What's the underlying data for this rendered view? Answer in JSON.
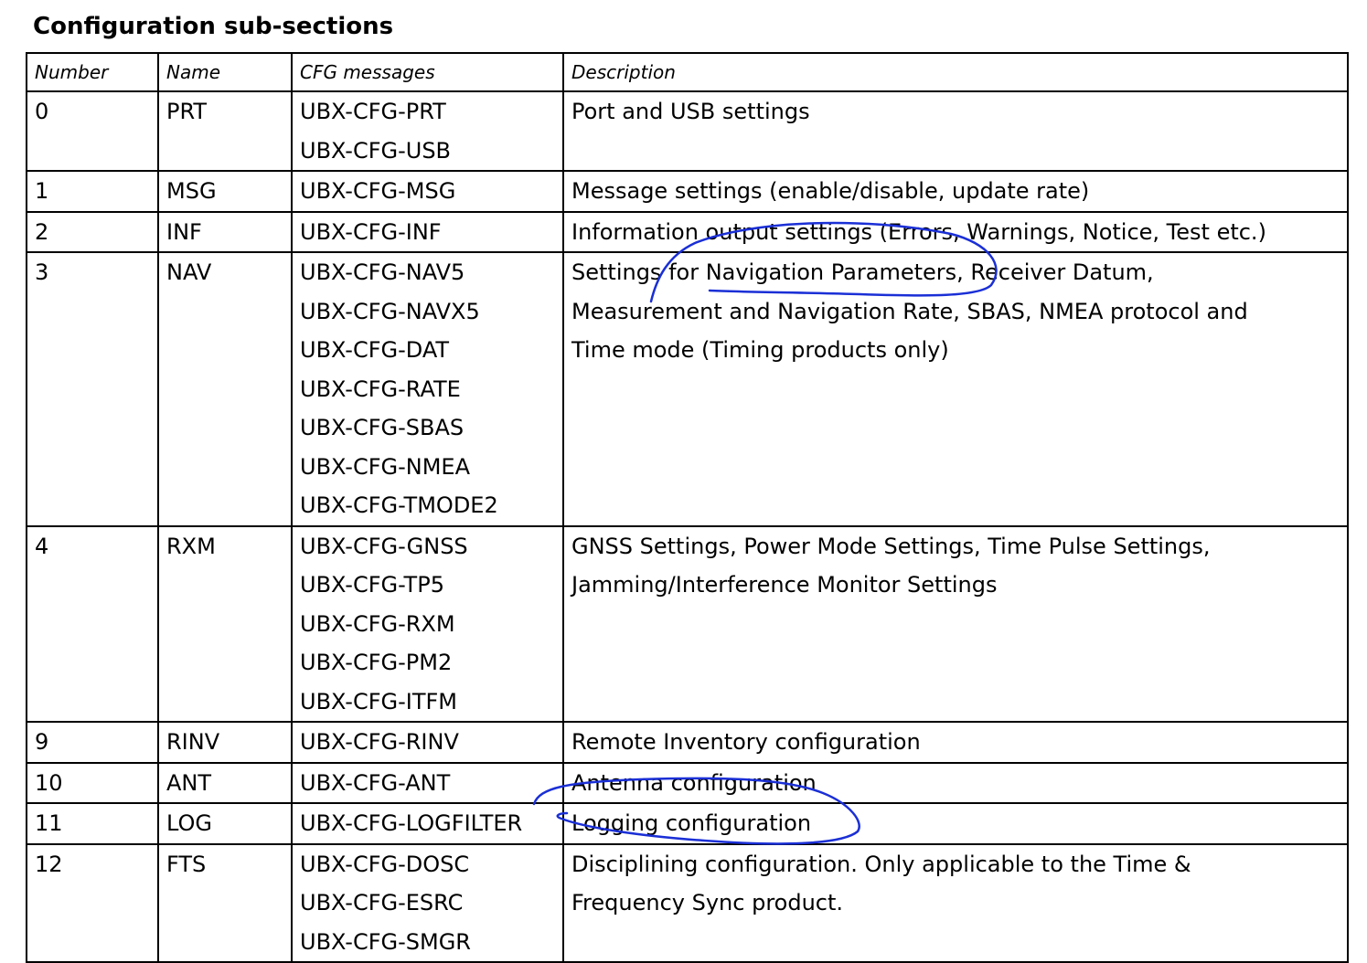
{
  "title": "Configuration sub-sections",
  "headers": {
    "number": "Number",
    "name": "Name",
    "cfg": "CFG messages",
    "description": "Description"
  },
  "rows": [
    {
      "number": "0",
      "name": "PRT",
      "cfg": [
        "UBX-CFG-PRT",
        "UBX-CFG-USB"
      ],
      "description": [
        "Port and USB settings"
      ]
    },
    {
      "number": "1",
      "name": "MSG",
      "cfg": [
        "UBX-CFG-MSG"
      ],
      "description": [
        "Message settings (enable/disable, update rate)"
      ]
    },
    {
      "number": "2",
      "name": "INF",
      "cfg": [
        "UBX-CFG-INF"
      ],
      "description": [
        "Information output settings (Errors, Warnings, Notice, Test etc.)"
      ]
    },
    {
      "number": "3",
      "name": "NAV",
      "cfg": [
        "UBX-CFG-NAV5",
        "UBX-CFG-NAVX5",
        "UBX-CFG-DAT",
        "UBX-CFG-RATE",
        "UBX-CFG-SBAS",
        "UBX-CFG-NMEA",
        "UBX-CFG-TMODE2"
      ],
      "description": [
        "Settings for Navigation Parameters, Receiver Datum,",
        "Measurement and Navigation Rate, SBAS, NMEA protocol and",
        "Time mode (Timing products only)"
      ]
    },
    {
      "number": "4",
      "name": "RXM",
      "cfg": [
        "UBX-CFG-GNSS",
        "UBX-CFG-TP5",
        "UBX-CFG-RXM",
        "UBX-CFG-PM2",
        "UBX-CFG-ITFM"
      ],
      "description": [
        "GNSS Settings, Power Mode Settings, Time Pulse Settings,",
        "Jamming/Interference Monitor Settings"
      ]
    },
    {
      "number": "9",
      "name": "RINV",
      "cfg": [
        "UBX-CFG-RINV"
      ],
      "description": [
        "Remote Inventory configuration"
      ]
    },
    {
      "number": "10",
      "name": "ANT",
      "cfg": [
        "UBX-CFG-ANT"
      ],
      "description": [
        "Antenna configuration"
      ]
    },
    {
      "number": "11",
      "name": "LOG",
      "cfg": [
        "UBX-CFG-LOGFILTER"
      ],
      "description": [
        "Logging configuration"
      ]
    },
    {
      "number": "12",
      "name": "FTS",
      "cfg": [
        "UBX-CFG-DOSC",
        "UBX-CFG-ESRC",
        "UBX-CFG-SMGR"
      ],
      "description": [
        "Disciplining configuration. Only applicable to the Time &",
        "Frequency Sync product."
      ]
    }
  ],
  "annotation_color": "#1a2fd6"
}
